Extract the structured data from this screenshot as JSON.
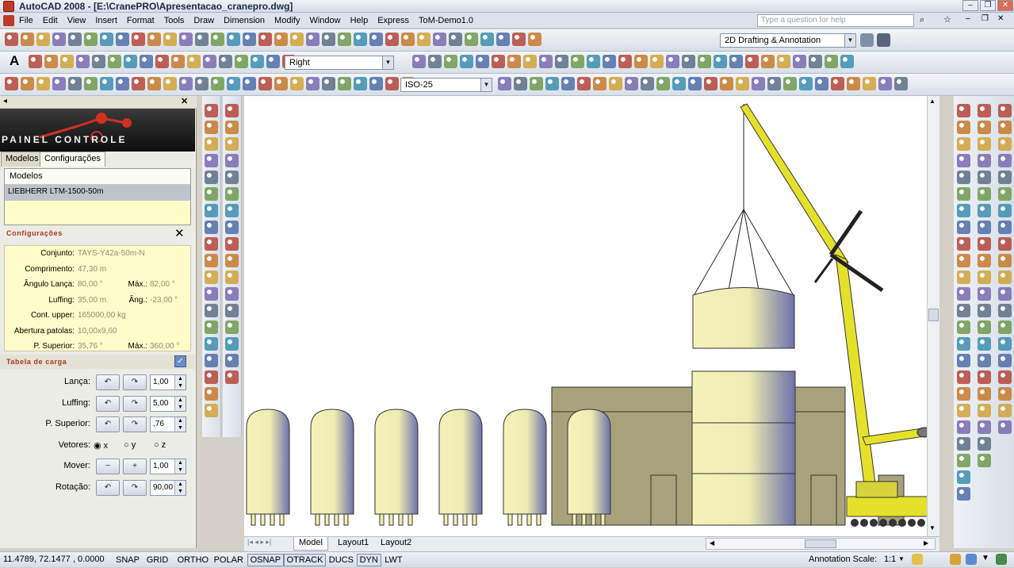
{
  "window": {
    "title": "AutoCAD 2008 - [E:\\CranePRO\\Apresentacao_cranepro.dwg]",
    "help_placeholder": "Type a question for help"
  },
  "menu": [
    "File",
    "Edit",
    "View",
    "Insert",
    "Format",
    "Tools",
    "Draw",
    "Dimension",
    "Modify",
    "Window",
    "Help",
    "Express",
    "ToM-Demo1.0"
  ],
  "toolbars": {
    "workspace": "2D Drafting & Annotation",
    "view_combo": "Right",
    "dimstyle_combo": "ISO-25"
  },
  "panel": {
    "logo_text": "PAINEL CONTROLE",
    "tabs": [
      "Modelos",
      "Configurações"
    ],
    "active_tab": "Configurações",
    "modelos_header": "Modelos",
    "selected_model": "LIEBHERR LTM-1500-50m",
    "config_title": "Configurações",
    "config": [
      {
        "label": "Conjunto:",
        "value": "TAYS-Y42a-50m-N"
      },
      {
        "label": "Comprimento:",
        "value": "47,30 m"
      },
      {
        "label": "Ângulo Lança:",
        "value": "80,00 °",
        "label2": "Máx.:",
        "value2": "82,00 °"
      },
      {
        "label": "Luffing:",
        "value": "35,00 m",
        "label2": "Âng.:",
        "value2": "-23,00 °"
      },
      {
        "label": "Cont. upper:",
        "value": "165000,00 kg"
      },
      {
        "label": "Abertura patolas:",
        "value": "10,00x9,60"
      },
      {
        "label": "P. Superior:",
        "value": "35,76 °",
        "label2": "Máx.:",
        "value2": "360,00 °"
      }
    ],
    "tabela_title": "Tabela de carga",
    "controls": [
      {
        "label": "Lança:",
        "value": "1,00"
      },
      {
        "label": "Luffing:",
        "value": "5,00"
      },
      {
        "label": "P. Superior:",
        "value": ",76"
      },
      {
        "label": "Vetores:",
        "options": [
          "x",
          "y",
          "z"
        ],
        "selected": "x"
      },
      {
        "label": "Mover:",
        "value": "1,00",
        "minus": "−",
        "plus": "+"
      },
      {
        "label": "Rotação:",
        "value": "90,00"
      }
    ]
  },
  "layout_tabs": [
    "Model",
    "Layout1",
    "Layout2"
  ],
  "active_layout": "Model",
  "status": {
    "coords": "11.4789, 72.1477 , 0.0000",
    "buttons": [
      "SNAP",
      "GRID",
      "ORTHO",
      "POLAR",
      "OSNAP",
      "OTRACK",
      "DUCS",
      "DYN",
      "LWT"
    ],
    "active_buttons": [
      "OSNAP",
      "OTRACK",
      "DYN"
    ],
    "annotation_scale_label": "Annotation Scale:",
    "annotation_scale_value": "1:1"
  },
  "colors": {
    "tank_fill": "#f1efb0",
    "tank_shade": "#6b6fa8",
    "building": "#a8a27c",
    "crane": "#e5e12a",
    "logo_red": "#d03020"
  }
}
